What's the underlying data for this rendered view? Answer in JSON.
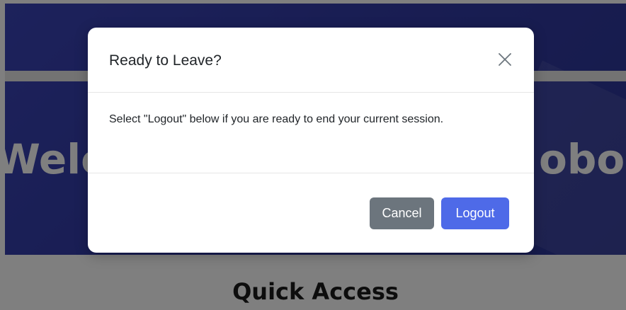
{
  "hero": {
    "title_left": "Welc",
    "title_right": "obo"
  },
  "section": {
    "title": "Quick Access"
  },
  "modal": {
    "title": "Ready to Leave?",
    "close_icon": "close-icon",
    "body": "Select \"Logout\" below if you are ready to end your current session.",
    "cancel_label": "Cancel",
    "logout_label": "Logout"
  },
  "colors": {
    "hero_bg": "#333ca8",
    "cancel_bg": "#6c757d",
    "logout_bg": "#4e6ae8",
    "backdrop": "rgba(0,0,0,0.5)"
  }
}
